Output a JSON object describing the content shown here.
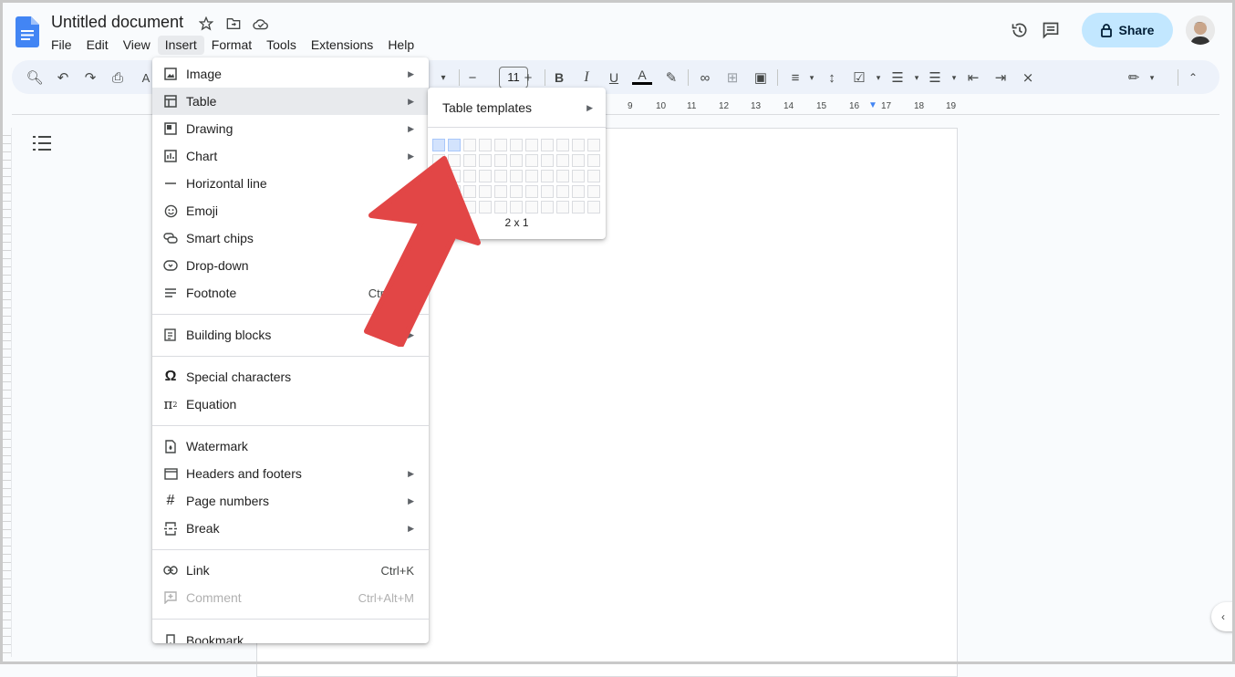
{
  "app": {
    "title": "Untitled document",
    "menus": [
      "File",
      "Edit",
      "View",
      "Insert",
      "Format",
      "Tools",
      "Extensions",
      "Help"
    ],
    "share_label": "Share"
  },
  "toolbar": {
    "font_size": "11"
  },
  "ruler": {
    "ticks": [
      "9",
      "10",
      "11",
      "12",
      "13",
      "14",
      "15",
      "16",
      "17",
      "18",
      "19"
    ]
  },
  "insert_menu": {
    "items": [
      {
        "label": "Image",
        "icon": "image-icon",
        "submenu": true
      },
      {
        "label": "Table",
        "icon": "table-icon",
        "submenu": true
      },
      {
        "label": "Drawing",
        "icon": "drawing-icon",
        "submenu": true
      },
      {
        "label": "Chart",
        "icon": "chart-icon",
        "submenu": true
      },
      {
        "label": "Horizontal line",
        "icon": "horizontal-line-icon"
      },
      {
        "label": "Emoji",
        "icon": "emoji-icon"
      },
      {
        "label": "Smart chips",
        "icon": "smart-chips-icon"
      },
      {
        "label": "Drop-down",
        "icon": "dropdown-icon"
      },
      {
        "label": "Footnote",
        "icon": "footnote-icon",
        "shortcut": "Ctrl"
      },
      {
        "label": "Building blocks",
        "icon": "building-blocks-icon",
        "submenu": true
      },
      {
        "label": "Special characters",
        "icon": "omega-icon"
      },
      {
        "label": "Equation",
        "icon": "pi-icon"
      },
      {
        "label": "Watermark",
        "icon": "watermark-icon"
      },
      {
        "label": "Headers and footers",
        "icon": "headers-footers-icon",
        "submenu": true
      },
      {
        "label": "Page numbers",
        "icon": "hash-icon",
        "submenu": true
      },
      {
        "label": "Break",
        "icon": "break-icon",
        "submenu": true
      },
      {
        "label": "Link",
        "icon": "link-icon",
        "shortcut": "Ctrl+K"
      },
      {
        "label": "Comment",
        "icon": "comment-icon",
        "shortcut": "Ctrl+Alt+M",
        "disabled": true
      },
      {
        "label": "Bookmark",
        "icon": "bookmark-icon"
      }
    ]
  },
  "table_submenu": {
    "templates_label": "Table templates",
    "grid_size_label": "2 x 1"
  },
  "colors": {
    "accent": "#c2e7ff",
    "arrow": "#e24646",
    "grid_selected": "#d3e3fd"
  }
}
